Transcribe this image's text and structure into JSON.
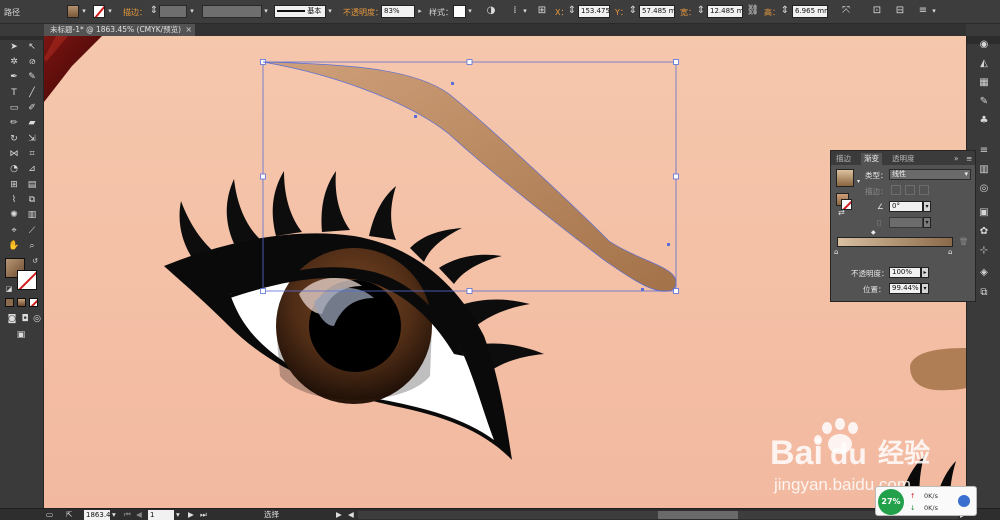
{
  "control_bar": {
    "mode_label": "路径",
    "stroke_label": "描边：",
    "stroke_style": "基本",
    "opacity_label": "不透明度：",
    "opacity_value": "83%",
    "style_label": "样式：",
    "x_label": "X：",
    "x_value": "153.475 r",
    "y_label": "Y：",
    "y_value": "57.485 m",
    "w_label": "宽：",
    "w_value": "12.485 m",
    "h_label": "高：",
    "h_value": "6.965 mm"
  },
  "document_tab": {
    "title": "未标题-1* @ 1863.45% (CMYK/预览)",
    "close_glyph": "×"
  },
  "gradient_panel": {
    "tabs": [
      "描边",
      "渐变",
      "透明度"
    ],
    "active_tab": "渐变",
    "type_label": "类型：",
    "type_value": "线性",
    "stroke_label": "描边：",
    "angle_value": "0°",
    "opacity_label": "不透明度：",
    "opacity_value": "100%",
    "location_label": "位置：",
    "location_value": "99.44%"
  },
  "status_bar": {
    "zoom_value": "1863.4",
    "page_value": "1",
    "tool_label": "选择"
  },
  "network_widget": {
    "percent": "27%",
    "up_rate": "0K/s",
    "down_rate": "0K/s"
  },
  "watermark": {
    "brand": "Bai",
    "brand2": "du",
    "chinese": "经验",
    "url": "jingyan.baidu.com"
  },
  "colors": {
    "canvas_skin": "#f4c5aa",
    "brow_light": "#c99a72",
    "brow_dark": "#a6764d",
    "iris": "#7a4a26",
    "selection": "#5b6fd6",
    "panel_bg": "#535353"
  },
  "icons": {
    "tools": [
      "selection-arrow-icon",
      "direct-select-icon",
      "magic-wand-icon",
      "lasso-icon",
      "pen-icon",
      "curvature-icon",
      "type-icon",
      "line-icon",
      "rectangle-icon",
      "paintbrush-icon",
      "pencil-icon",
      "eraser-icon",
      "rotate-icon",
      "scale-icon",
      "width-icon",
      "free-transform-icon",
      "shape-builder-icon",
      "perspective-icon",
      "mesh-icon",
      "gradient-icon",
      "eyedropper-icon",
      "blend-icon",
      "symbol-sprayer-icon",
      "graph-icon",
      "artboard-icon",
      "slice-icon",
      "hand-icon",
      "zoom-icon"
    ]
  }
}
